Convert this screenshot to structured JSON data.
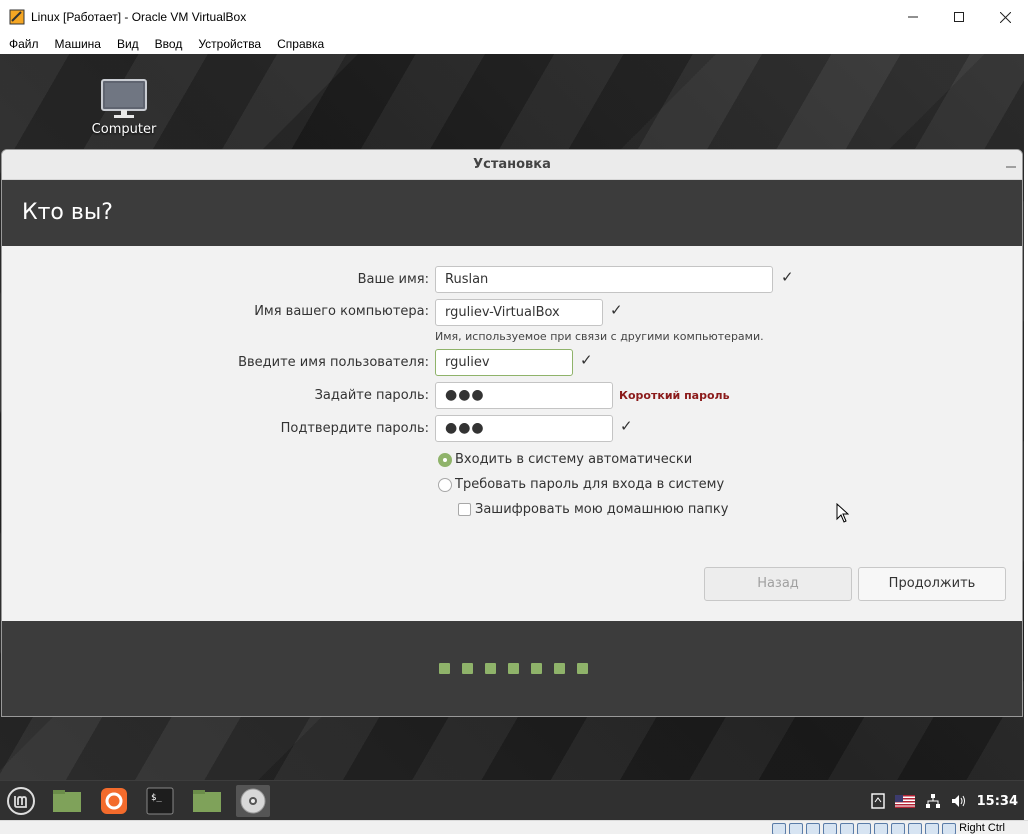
{
  "host_window": {
    "title": "Linux [Работает] - Oracle VM VirtualBox",
    "menu": [
      "Файл",
      "Машина",
      "Вид",
      "Ввод",
      "Устройства",
      "Справка"
    ]
  },
  "desktop": {
    "icon_label": "Computer"
  },
  "installer": {
    "window_title": "Установка",
    "heading": "Кто вы?",
    "fields": {
      "name_label": "Ваше имя:",
      "name_value": "Ruslan",
      "computer_label": "Имя вашего компьютера:",
      "computer_value": "rguliev-VirtualBox",
      "computer_hint": "Имя, используемое при связи с другими компьютерами.",
      "username_label": "Введите имя пользователя:",
      "username_value": "rguliev",
      "password_label": "Задайте пароль:",
      "password_value": "●●●",
      "password_warning": "Короткий пароль",
      "confirm_label": "Подтвердите пароль:",
      "confirm_value": "●●●"
    },
    "options": {
      "auto_login": "Входить в систему автоматически",
      "require_password": "Требовать пароль для входа в систему",
      "encrypt_home": "Зашифровать мою домашнюю папку"
    },
    "buttons": {
      "back": "Назад",
      "continue": "Продолжить"
    },
    "progress_steps": 7
  },
  "taskbar": {
    "clock": "15:34"
  },
  "vbox_status": {
    "host_key": "Right Ctrl"
  },
  "colors": {
    "accent": "#8fb36a",
    "header_bg": "#3c3c3c",
    "warning": "#8b1a1a"
  }
}
